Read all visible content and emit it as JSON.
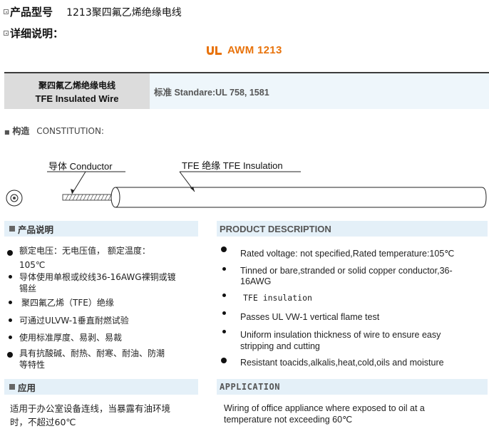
{
  "header": {
    "model_label": "产品型号",
    "model_value": "1213聚四氟乙烯绝缘电线",
    "detail_label": "详细说明："
  },
  "cert": {
    "text": "AWM 1213",
    "mark": "UL",
    "color": "#e8730c"
  },
  "spec": {
    "name_cn": "聚四氟乙烯绝缘电线",
    "name_en": "TFE Insulated Wire",
    "standard": "标准   Standare:UL 758, 1581"
  },
  "construction": {
    "title": "构造",
    "title_en": "CONSTITUTION:",
    "conductor_label": "导体 Conductor",
    "insulation_label": "TFE 绝缘 TFE Insulation"
  },
  "desc_cn": {
    "title": "产品说明",
    "items": [
      "额定电压：无电压值，  额定温度：",
      "105℃",
      "导体使用单根或绞线36-16AWG裸铜或镀",
      "锡丝",
      "聚四氟乙烯（TFE）绝缘",
      "可通过ULVW-1垂直耐燃试验",
      "使用标准厚度、易剥、易裁",
      "具有抗酸碱、耐热、耐寒、耐油、防潮",
      "等特性"
    ]
  },
  "desc_en": {
    "title": "PRODUCT DESCRIPTION",
    "items": [
      "Rated voltage: not specified,Rated temperature:105℃",
      "Tinned or bare,stranded or solid copper conductor,36-",
      "16AWG",
      "TFE insulation",
      "Passes UL VW-1 vertical flame test",
      "Uniform insulation thickness of wire to ensure easy",
      "stripping and cutting",
      "Resistant toacids,alkalis,heat,cold,oils and moisture"
    ]
  },
  "app_cn": {
    "title": "应用",
    "lines": [
      "适用于办公室设备连线，当暴露有油环境",
      "时，不超过60℃"
    ]
  },
  "app_en": {
    "title": "APPLICATION",
    "lines": [
      "Wiring of office appliance where exposed to oil at a",
      "temperature not exceeding 60℃"
    ]
  }
}
